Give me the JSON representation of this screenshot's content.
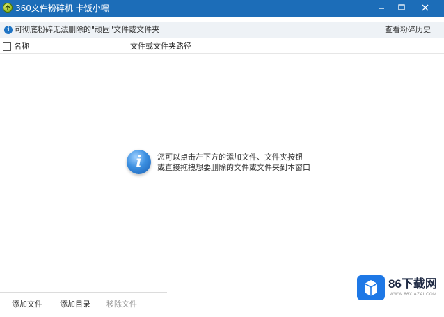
{
  "window": {
    "title": "360文件粉碎机 卡饭小嘿"
  },
  "infobar": {
    "text": "可彻底粉碎无法删除的\"顽固\"文件或文件夹",
    "history_link": "查看粉碎历史"
  },
  "list": {
    "columns": [
      "名称",
      "文件或文件夹路径"
    ],
    "empty_hint": [
      "您可以点击左下方的添加文件、文件夹按钮",
      "或直接拖拽想要删除的文件或文件夹到本窗口"
    ]
  },
  "toolbar": {
    "add_file_label": "添加文件",
    "add_dir_label": "添加目录",
    "remove_file_label": "移除文件"
  },
  "watermark": {
    "brand": "86下载网",
    "url": "WWW.86XIAZAI.COM"
  },
  "colors": {
    "titlebar": "#1c6db8",
    "infobar": "#eef2f6",
    "accent": "#1f74c4",
    "disabled_text": "#999999"
  },
  "icons": {
    "app": "shredder-app-icon",
    "info": "info-icon",
    "hint": "info-circle-icon",
    "minimize": "minimize-icon",
    "maximize": "maximize-icon",
    "close": "close-icon"
  }
}
